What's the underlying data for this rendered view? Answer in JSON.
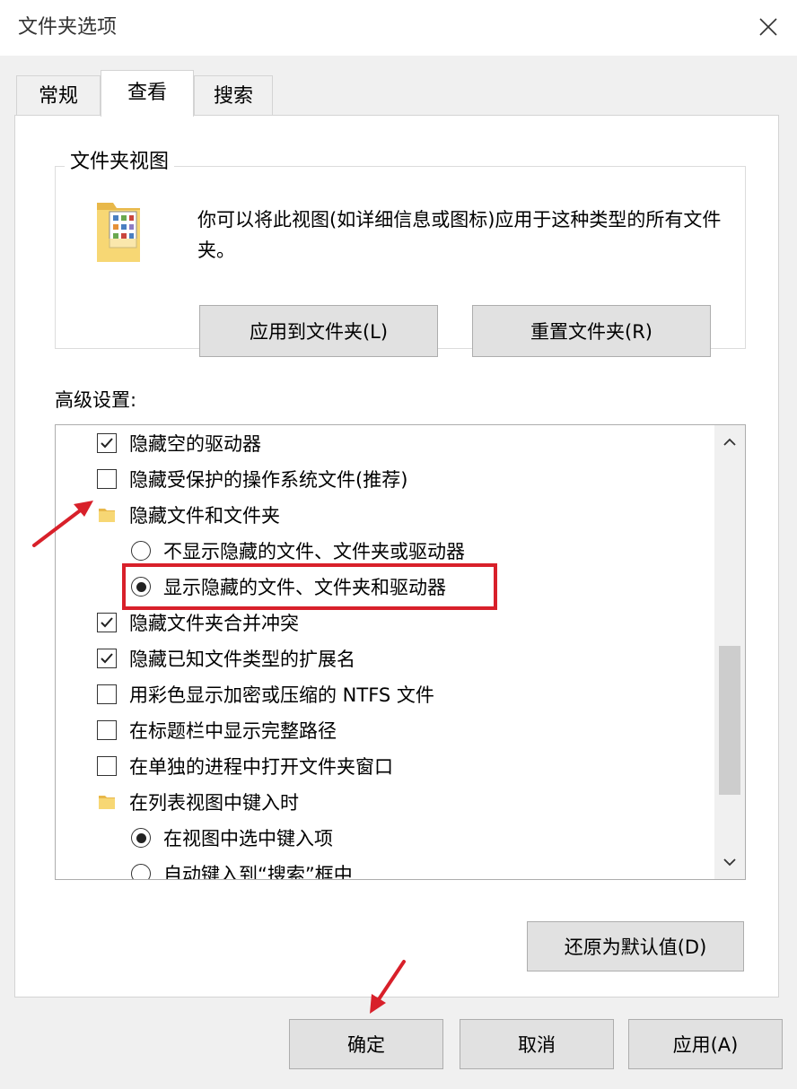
{
  "window": {
    "title": "文件夹选项"
  },
  "tabs": [
    {
      "label": "常规"
    },
    {
      "label": "查看"
    },
    {
      "label": "搜索"
    }
  ],
  "folder_views": {
    "legend": "文件夹视图",
    "description": "你可以将此视图(如详细信息或图标)应用于这种类型的所有文件夹。",
    "apply_button": "应用到文件夹(L)",
    "reset_button": "重置文件夹(R)"
  },
  "advanced": {
    "label": "高级设置:",
    "items": [
      {
        "type": "checkbox",
        "checked": true,
        "indent": 0,
        "label": "隐藏空的驱动器"
      },
      {
        "type": "checkbox",
        "checked": false,
        "indent": 0,
        "label": "隐藏受保护的操作系统文件(推荐)"
      },
      {
        "type": "folder",
        "indent": 0,
        "label": "隐藏文件和文件夹"
      },
      {
        "type": "radio",
        "checked": false,
        "indent": 1,
        "label": "不显示隐藏的文件、文件夹或驱动器"
      },
      {
        "type": "radio",
        "checked": true,
        "indent": 1,
        "label": "显示隐藏的文件、文件夹和驱动器"
      },
      {
        "type": "checkbox",
        "checked": true,
        "indent": 0,
        "label": "隐藏文件夹合并冲突"
      },
      {
        "type": "checkbox",
        "checked": true,
        "indent": 0,
        "label": "隐藏已知文件类型的扩展名"
      },
      {
        "type": "checkbox",
        "checked": false,
        "indent": 0,
        "label": "用彩色显示加密或压缩的 NTFS 文件"
      },
      {
        "type": "checkbox",
        "checked": false,
        "indent": 0,
        "label": "在标题栏中显示完整路径"
      },
      {
        "type": "checkbox",
        "checked": false,
        "indent": 0,
        "label": "在单独的进程中打开文件夹窗口"
      },
      {
        "type": "folder",
        "indent": 0,
        "label": "在列表视图中键入时"
      },
      {
        "type": "radio",
        "checked": true,
        "indent": 1,
        "label": "在视图中选中键入项"
      },
      {
        "type": "radio",
        "checked": false,
        "indent": 1,
        "label": "自动键入到“搜索”框中"
      }
    ],
    "restore_button": "还原为默认值(D)"
  },
  "footer": {
    "ok": "确定",
    "cancel": "取消",
    "apply": "应用(A)"
  },
  "colors": {
    "annotation": "#d8202a",
    "folder_yellow": "#f7d774",
    "folder_dark": "#e8b84a"
  }
}
